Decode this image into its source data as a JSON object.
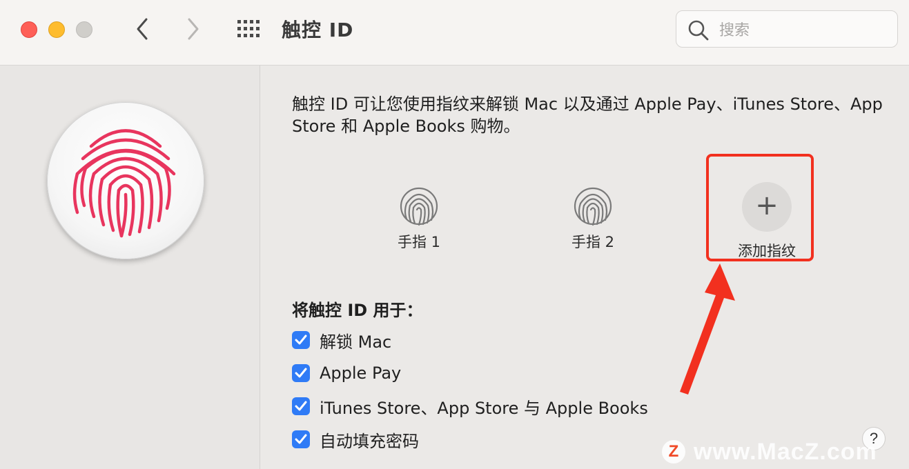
{
  "toolbar": {
    "title": "触控 ID",
    "search_placeholder": "搜索",
    "icons": {
      "back": "chevron-left-icon",
      "forward": "chevron-right-icon",
      "grid": "grid-icon",
      "search": "search-icon"
    }
  },
  "content": {
    "description": "触控 ID 可让您使用指纹来解锁 Mac 以及通过 Apple Pay、iTunes Store、App Store 和 Apple Books 购物。",
    "fingerprints": [
      {
        "label": "手指 1"
      },
      {
        "label": "手指 2"
      }
    ],
    "add_fingerprint": {
      "symbol": "+",
      "label": "添加指纹"
    },
    "use_title": "将触控 ID 用于：",
    "options": [
      {
        "label": "解锁 Mac",
        "checked": true
      },
      {
        "label": "Apple Pay",
        "checked": true
      },
      {
        "label": "iTunes Store、App Store 与 Apple Books",
        "checked": true
      },
      {
        "label": "自动填充密码",
        "checked": true
      }
    ],
    "help_label": "?"
  },
  "watermark": {
    "logo": "Z",
    "text": "www.MacZ.com"
  },
  "colors": {
    "accent": "#2f7bf6",
    "fingerprint": "#e8355e",
    "highlight": "#f2301f",
    "close": "#fe5f57",
    "minimize": "#febc2e"
  }
}
